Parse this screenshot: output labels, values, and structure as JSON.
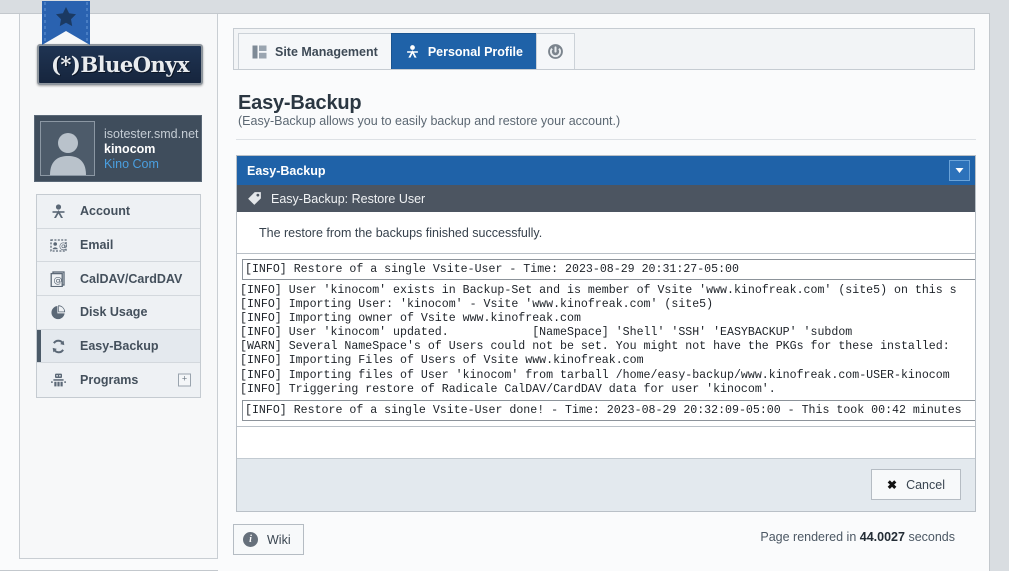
{
  "branding": {
    "logo_text": "(*)BlueOnyx",
    "ribbon_icon": "star-ribbon-icon"
  },
  "sidebar": {
    "user": {
      "host": "isotester.smd.net",
      "username": "kinocom",
      "fullname": "Kino Com",
      "avatar_icon": "user-avatar-icon"
    },
    "items": [
      {
        "label": "Account",
        "icon": "account-person-icon",
        "active": false,
        "expandable": false
      },
      {
        "label": "Email",
        "icon": "email-card-icon",
        "active": false,
        "expandable": false
      },
      {
        "label": "CalDAV/CardDAV",
        "icon": "calendar-card-icon",
        "active": false,
        "expandable": false
      },
      {
        "label": "Disk Usage",
        "icon": "pie-chart-icon",
        "active": false,
        "expandable": false
      },
      {
        "label": "Easy-Backup",
        "icon": "refresh-cycle-icon",
        "active": true,
        "expandable": false
      },
      {
        "label": "Programs",
        "icon": "robot-icon",
        "active": false,
        "expandable": true,
        "expand_glyph": "+"
      }
    ]
  },
  "tabs": [
    {
      "label": "Site Management",
      "icon": "layout-columns-icon",
      "active": false
    },
    {
      "label": "Personal Profile",
      "icon": "person-network-icon",
      "active": true
    },
    {
      "label": "",
      "icon": "logout-circle-icon",
      "active": false,
      "icon_only": true
    }
  ],
  "page": {
    "title": "Easy-Backup",
    "subtitle": "(Easy-Backup allows you to easily backup and restore your account.)"
  },
  "panel": {
    "header_title": "Easy-Backup",
    "collapse_icon": "chevron-down-icon",
    "subheader_icon": "tag-icon",
    "subheader_title": "Easy-Backup: Restore User",
    "status_message": "The restore from the backups finished successfully.",
    "log_header_line": "[INFO] Restore of a single Vsite-User - Time: 2023-08-29 20:31:27-05:00",
    "log_lines": [
      "[INFO] User 'kinocom' exists in Backup-Set and is member of Vsite 'www.kinofreak.com' (site5) on this s",
      "[INFO] Importing User: 'kinocom' - Vsite 'www.kinofreak.com' (site5)",
      "[INFO] Importing owner of Vsite www.kinofreak.com",
      "[INFO] User 'kinocom' updated.            [NameSpace] 'Shell' 'SSH' 'EASYBACKUP' 'subdom",
      "[WARN] Several NameSpace's of Users could not be set. You might not have the PKGs for these installed:",
      "[INFO] Importing Files of Users of Vsite www.kinofreak.com",
      "[INFO] Importing files of User 'kinocom' from tarball /home/easy-backup/www.kinofreak.com-USER-kinocom",
      "[INFO] Triggering restore of Radicale CalDAV/CardDAV data for user 'kinocom'."
    ],
    "log_footer_line": "[INFO] Restore of a single Vsite-User done! - Time: 2023-08-29 20:32:09-05:00 - This took 00:42 minutes",
    "cancel_label": "Cancel",
    "cancel_icon": "close-x-icon"
  },
  "footer": {
    "wiki_label": "Wiki",
    "wiki_icon": "info-circle-icon",
    "rendered_prefix": "Page rendered in",
    "rendered_value": "44.0027",
    "rendered_suffix": "seconds"
  },
  "colors": {
    "accent_blue": "#1f62a8",
    "subhead_gray": "#4c5561",
    "link_blue": "#4a9fe0",
    "page_bg": "#d9dde1"
  }
}
